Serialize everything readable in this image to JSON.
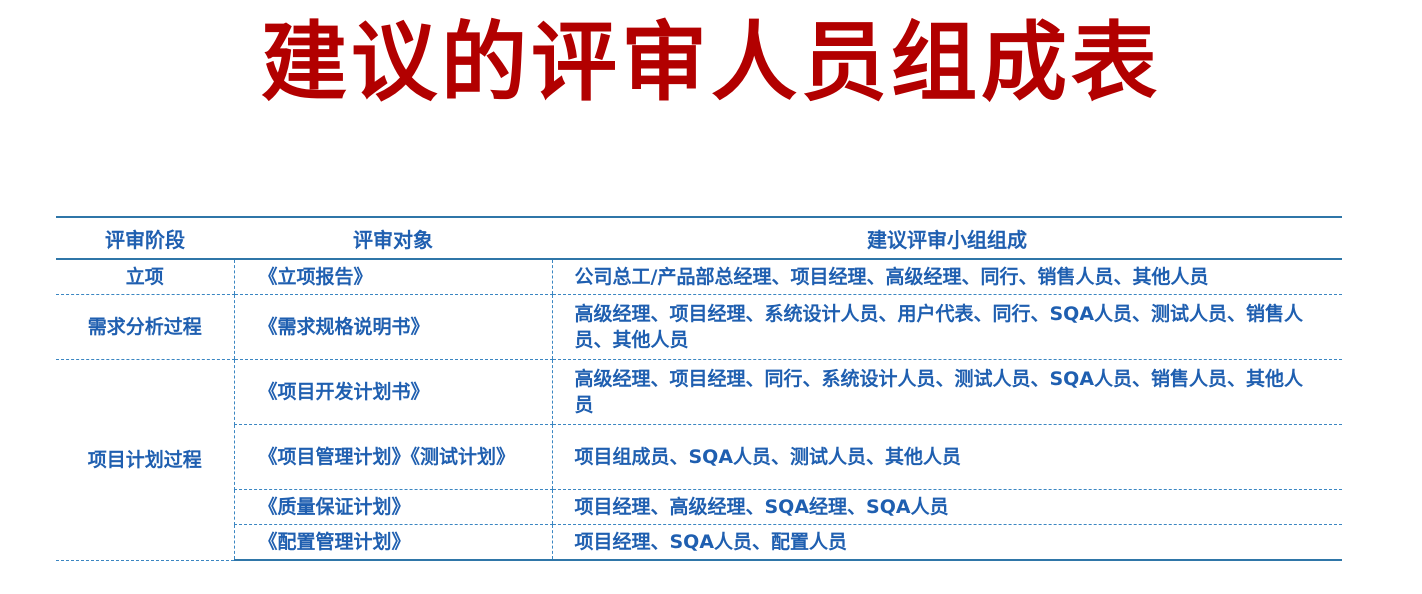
{
  "title": "建议的评审人员组成表",
  "table": {
    "headers": {
      "stage": "评审阶段",
      "object": "评审对象",
      "members": "建议评审小组组成"
    },
    "rows": [
      {
        "stage": "立项",
        "object": "《立项报告》",
        "members": "公司总工/产品部总经理、项目经理、高级经理、同行、销售人员、其他人员"
      },
      {
        "stage": "需求分析过程",
        "object": "《需求规格说明书》",
        "members": "高级经理、项目经理、系统设计人员、用户代表、同行、SQA人员、测试人员、销售人员、其他人员"
      },
      {
        "stage": "项目计划过程",
        "object": "《项目开发计划书》",
        "members": "高级经理、项目经理、同行、系统设计人员、测试人员、SQA人员、销售人员、其他人员"
      },
      {
        "object": "《项目管理计划》《测试计划》",
        "members": "项目组成员、SQA人员、测试人员、其他人员"
      },
      {
        "object": "《质量保证计划》",
        "members": "项目经理、高级经理、SQA经理、SQA人员"
      },
      {
        "object": "《配置管理计划》",
        "members": "项目经理、SQA人员、配置人员"
      }
    ]
  }
}
